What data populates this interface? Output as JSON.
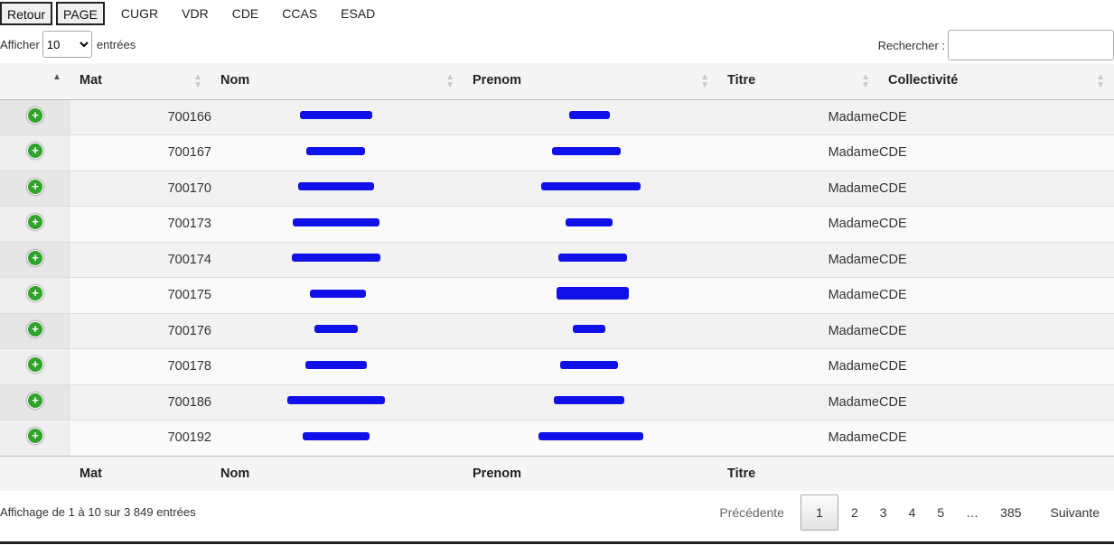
{
  "nav": {
    "retour": "Retour",
    "page": "PAGE",
    "links": [
      "CUGR",
      "VDR",
      "CDE",
      "CCAS",
      "ESAD"
    ]
  },
  "length": {
    "before": "Afficher",
    "value": "10",
    "after": "entrées"
  },
  "search": {
    "label": "Rechercher :",
    "value": ""
  },
  "table": {
    "headers": [
      "Mat",
      "Nom",
      "Prenom",
      "Titre",
      "Collectivité"
    ],
    "footers": [
      "Mat",
      "Nom",
      "Prenom",
      "Titre",
      ""
    ],
    "rows": [
      {
        "mat": "700166",
        "titre": "Madame",
        "coll": "CDE"
      },
      {
        "mat": "700167",
        "titre": "Madame",
        "coll": "CDE"
      },
      {
        "mat": "700170",
        "titre": "Madame",
        "coll": "CDE"
      },
      {
        "mat": "700173",
        "titre": "Madame",
        "coll": "CDE"
      },
      {
        "mat": "700174",
        "titre": "Madame",
        "coll": "CDE"
      },
      {
        "mat": "700175",
        "titre": "Madame",
        "coll": "CDE"
      },
      {
        "mat": "700176",
        "titre": "Madame",
        "coll": "CDE"
      },
      {
        "mat": "700178",
        "titre": "Madame",
        "coll": "CDE"
      },
      {
        "mat": "700186",
        "titre": "Madame",
        "coll": "CDE"
      },
      {
        "mat": "700192",
        "titre": "Madame",
        "coll": "CDE"
      }
    ]
  },
  "info": "Affichage de 1 à 10 sur 3 849 entrées",
  "paging": {
    "previous": "Précédente",
    "current": "1",
    "pages": [
      "2",
      "3",
      "4",
      "5"
    ],
    "ellipsis": "…",
    "last": "385",
    "next": "Suivante"
  },
  "colors": {
    "redaction": "#1010e8",
    "expand_icon": "#31a22c"
  },
  "icons": {
    "expand": "plus-circle-icon",
    "sort": "sort-arrows-icon"
  }
}
